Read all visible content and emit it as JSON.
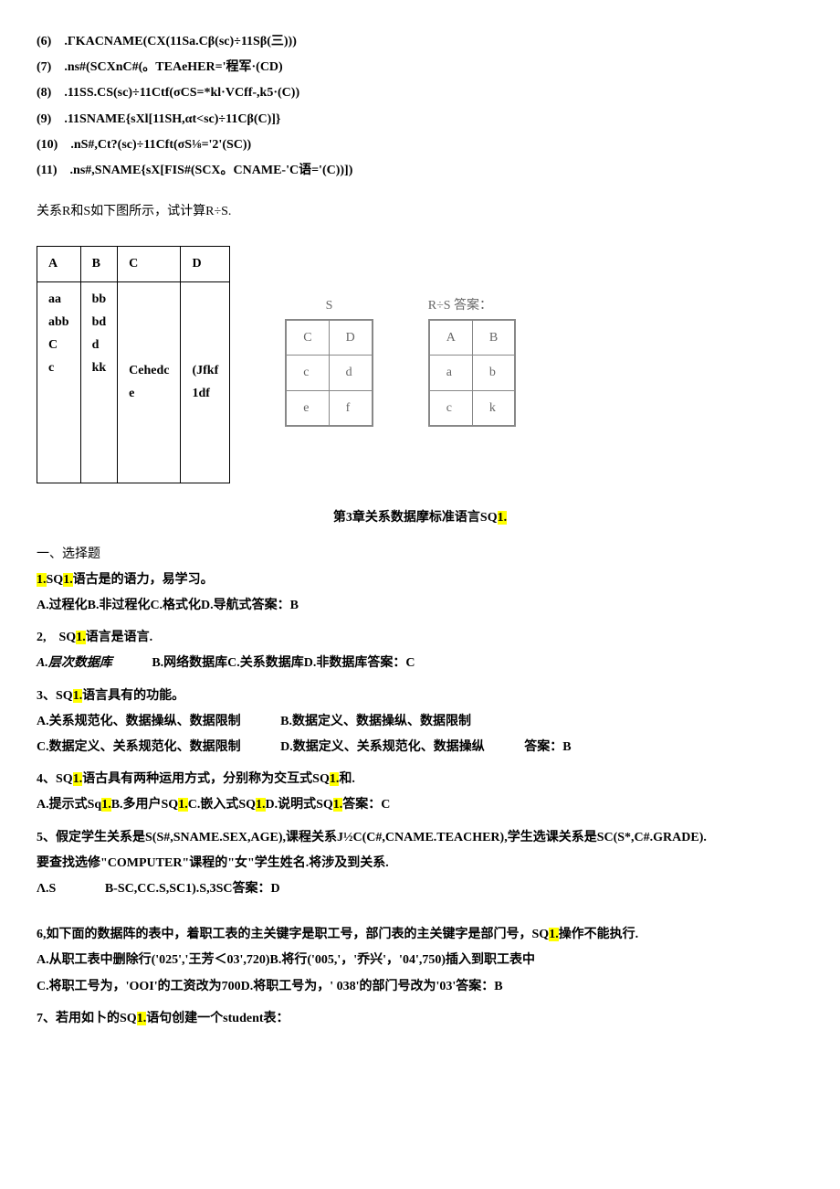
{
  "formulas": {
    "f6": "(6)　.ΓKACNAME(CX(11Sa.Cβ(sc)÷11Sβ(三)))",
    "f7": "(7)　.ns#(SCXnC#(。TEAeHER='程军·(CD)",
    "f8": "(8)　.11SS.CS(sc)÷11Ctf(σCS=*kl·VCff-,k5·(C))",
    "f9": "(9)　.11SNAME{sXl[11SH,αt<sc)÷11Cβ(C)]}",
    "f10": "(10)　.nS#,Ct?(sc)÷11Cft(σS⅛='2'(SC))",
    "f11": "(11)　.ns#,SNAME{sX[FIS#(SCX。CNAME-'C语='(C))])"
  },
  "rs_prompt": "关系R和S如下图所示，试计算R÷S.",
  "table_r": {
    "headers": [
      "A",
      "B",
      "C",
      "D"
    ],
    "col_a": "aa\nabb\nC\nc",
    "col_b": "bb\nbd\nd\nkk",
    "col_c": "Cehedc\ne",
    "col_d": "(Jfkf\n1df"
  },
  "image_s": {
    "title": "S",
    "rows": [
      [
        "C",
        "D"
      ],
      [
        "c",
        "d"
      ],
      [
        "e",
        "f"
      ]
    ]
  },
  "image_rs": {
    "title": "R÷S 答案：",
    "rows": [
      [
        "A",
        "B"
      ],
      [
        "a",
        "b"
      ],
      [
        "c",
        "k"
      ]
    ]
  },
  "chapter_title_pre": "第3章关系数据摩标准语言SQ",
  "chapter_title_suf": "1.",
  "sec1": "一、选择题",
  "q1": {
    "num_pre": "1.",
    "num_mid": "SQ",
    "num_hl": "1.",
    "rest": "语古是的语力，易学习。",
    "opts": "A.过程化B.非过程化C.格式化D.导航式答案：B"
  },
  "q2": {
    "num": "2,　SQ",
    "hl": "1.",
    "rest": "语言是语言.",
    "opts_a": "A.层次数据库",
    "opts_b": "B.网络数据库C.关系数据库D.非数据库答案：C"
  },
  "q3": {
    "num": "3、SQ",
    "hl": "1.",
    "rest": "语言具有的功能。",
    "row1a": "A.关系规范化、数据操纵、数据限制",
    "row1b": "B.数据定义、数据操纵、数据限制",
    "row2a": "C.数据定义、关系规范化、数据限制",
    "row2b": "D.数据定义、关系规范化、数据操纵",
    "ans": "答案：B"
  },
  "q4": {
    "num": "4、SQ",
    "hl1": "1.",
    "mid1": "语古具有两种运用方式，分别称为交互式SQ",
    "hl2": "1.",
    "mid2": "和.",
    "opt_a": "A.提示式Sq",
    "hla": "1.",
    "opt_b": "B.多用户SQ",
    "hlb": "1.",
    "opt_c": "C.嵌入式SQ",
    "hlc": "1.",
    "opt_d": "D.说明式SQ",
    "hld": "1.",
    "ans": "答案：C"
  },
  "q5": {
    "line1": "5、假定学生关系是S(S#,SNAME.SEX,AGE),课程关系J½C(C#,CNAME.TEACHER),学生选课关系是SC(S*,C#.GRADE).",
    "line2": "要查找选修\"COMPUTER\"课程的\"女\"学生姓名.将涉及到关系.",
    "opt_a": "Λ.S",
    "opt_rest": "B-SC,CC.S,SC1).S,3SC答案：D"
  },
  "q6": {
    "pre": "6,如下面的数据阵的表中，着职工表的主关键字是职工号，部门表的主关键字是部门号，SQ",
    "hl": "1.",
    "post": "操作不能执行.",
    "row1": "A.从职工表中删除行('025','王芳＜03',720)B.将行('005,'，'乔兴'，'04',750)插入到职工表中",
    "row2": "C.将职工号为，'OOI'的工资改为700D.将职工号为，'  038'的部门号改为'03'答案：B"
  },
  "q7": {
    "pre": "7、若用如卜的SQ",
    "hl": "1.",
    "post": "语句创建一个student表："
  }
}
